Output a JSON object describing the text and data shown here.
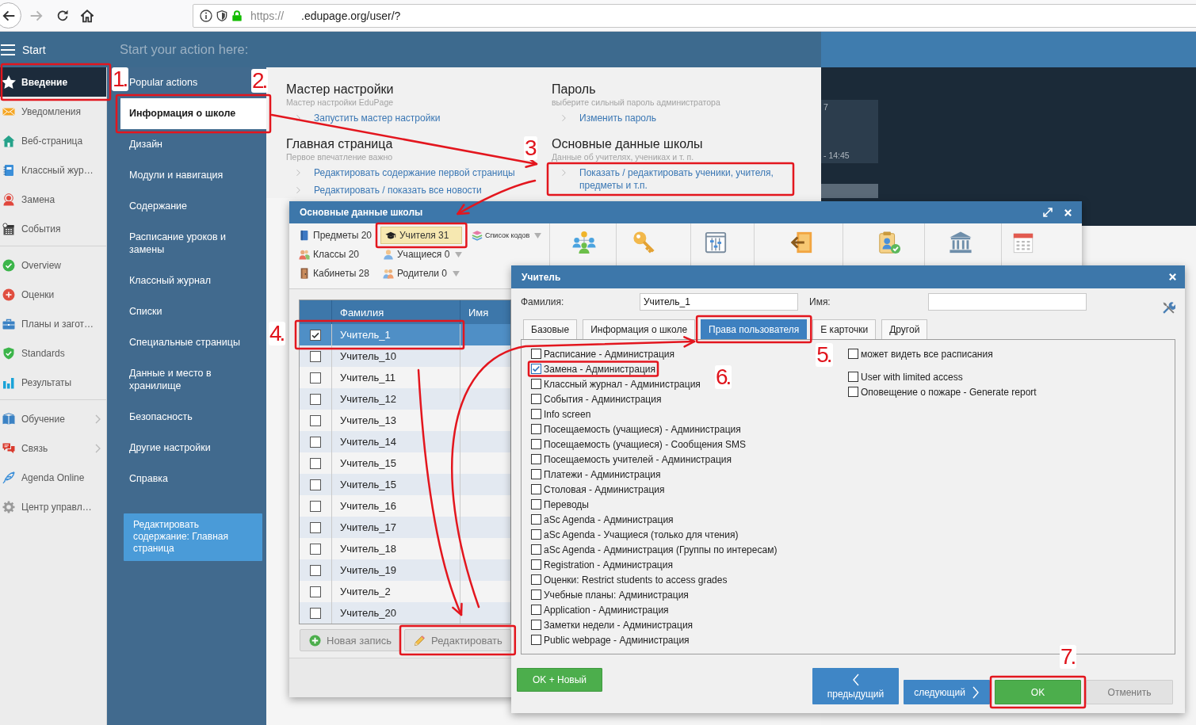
{
  "browser": {
    "url_scheme": "https://",
    "url_host": ".edupage.org/user/?"
  },
  "top_bar": {
    "start_label": "Start",
    "prompt": "Start your action here:"
  },
  "sidebar": {
    "groups": [
      {
        "items": [
          {
            "label": "Введение",
            "selected": true,
            "expandable": false,
            "highlight": {
              "step": "1.",
              "arrow_in": false
            }
          },
          {
            "label": "Уведомления",
            "selected": false,
            "expandable": false
          },
          {
            "label": "Веб-страница",
            "selected": false,
            "expandable": false
          },
          {
            "label": "Классный жур…",
            "selected": false,
            "expandable": false
          },
          {
            "label": "Замена",
            "selected": false,
            "expandable": false
          },
          {
            "label": "События",
            "selected": false,
            "expandable": false
          }
        ]
      },
      {
        "items": [
          {
            "label": "Overview",
            "selected": false,
            "expandable": false
          },
          {
            "label": "Оценки",
            "selected": false,
            "expandable": false
          },
          {
            "label": "Планы и загот…",
            "selected": false,
            "expandable": false
          },
          {
            "label": "Standards",
            "selected": false,
            "expandable": false
          },
          {
            "label": "Результаты",
            "selected": false,
            "expandable": false
          }
        ]
      },
      {
        "items": [
          {
            "label": "Обучение",
            "selected": false,
            "expandable": true
          },
          {
            "label": "Связь",
            "selected": false,
            "expandable": true
          },
          {
            "label": "Agenda Online",
            "selected": false,
            "expandable": false
          },
          {
            "label": "Центр управл…",
            "selected": false,
            "expandable": false
          }
        ]
      }
    ]
  },
  "menu": {
    "items": [
      {
        "label": "Popular actions",
        "selected": false
      },
      {
        "label": "Информация о школе",
        "selected": true,
        "highlight": {
          "step": "2.",
          "arrow_in": false
        }
      },
      {
        "label": "Дизайн",
        "selected": false
      },
      {
        "label": "Модули и навигация",
        "selected": false
      },
      {
        "label": "Содержание",
        "selected": false
      },
      {
        "label": "Расписание уроков и замены",
        "selected": false
      },
      {
        "label": "Классный журнал",
        "selected": false
      },
      {
        "label": "Списки",
        "selected": false
      },
      {
        "label": "Специальные страницы",
        "selected": false
      },
      {
        "label": "Данные и место в хранилище",
        "selected": false
      },
      {
        "label": "Безопасность",
        "selected": false
      },
      {
        "label": "Другие настройки",
        "selected": false
      },
      {
        "label": "Справка",
        "selected": false
      }
    ],
    "action_button": "Редактировать содержание: Главная страница"
  },
  "content": {
    "sections": [
      {
        "title": "Мастер настройки",
        "subtitle": "Мастер настройки EduPage",
        "links": [
          {
            "label": "Запустить мастер настройки"
          }
        ]
      },
      {
        "title": "Пароль",
        "subtitle": "выберите сильный пароль администратора",
        "links": [
          {
            "label": "Изменить пароль"
          }
        ]
      },
      {
        "title": "Главная страница",
        "subtitle": "Первое впечатление важно",
        "links": [
          {
            "label": "Редактировать содержание первой страницы"
          },
          {
            "label": "Редактировать / показать все новости"
          }
        ]
      },
      {
        "title": "Основные данные школы",
        "subtitle": "Данные об учителях, учениках и т. п.",
        "links": [
          {
            "label": "Показать / редактировать ученики, учителя, предметы и т.п.",
            "highlight": {
              "step": "3",
              "arrow_in": true
            }
          }
        ]
      }
    ]
  },
  "background_card": {
    "line_1": "7",
    "line_2": "- 14:45"
  },
  "school_data_dialog": {
    "title": "Основные данные школы",
    "toolbar_rows": [
      {
        "items": [
          {
            "label": "Предметы 20",
            "selected": false,
            "dropdown": false
          },
          {
            "label": "Учителя 31",
            "selected": true,
            "dropdown": false,
            "highlight": {
              "arrow_in": true
            }
          },
          {
            "label": "Список кодов",
            "selected": false,
            "dropdown": true
          }
        ]
      },
      {
        "items": [
          {
            "label": "Классы 20",
            "selected": false,
            "dropdown": false
          },
          {
            "label": "Учащиеся 0",
            "selected": false,
            "dropdown": true
          }
        ]
      },
      {
        "items": [
          {
            "label": "Кабинеты 28",
            "selected": false,
            "dropdown": false
          },
          {
            "label": "Родители 0",
            "selected": false,
            "dropdown": true
          }
        ]
      }
    ],
    "table": {
      "columns": [
        "Фамилия",
        "Имя"
      ],
      "rows": [
        {
          "surname": "Учитель_1",
          "checked": true,
          "selected": true,
          "highlight": {
            "step": "4.",
            "arrow_in": false
          }
        },
        {
          "surname": "Учитель_10",
          "checked": false,
          "selected": false
        },
        {
          "surname": "Учитель_11",
          "checked": false,
          "selected": false
        },
        {
          "surname": "Учитель_12",
          "checked": false,
          "selected": false
        },
        {
          "surname": "Учитель_13",
          "checked": false,
          "selected": false
        },
        {
          "surname": "Учитель_14",
          "checked": false,
          "selected": false
        },
        {
          "surname": "Учитель_15",
          "checked": false,
          "selected": false
        },
        {
          "surname": "Учитель_15",
          "checked": false,
          "selected": false
        },
        {
          "surname": "Учитель_16",
          "checked": false,
          "selected": false
        },
        {
          "surname": "Учитель_17",
          "checked": false,
          "selected": false
        },
        {
          "surname": "Учитель_18",
          "checked": false,
          "selected": false
        },
        {
          "surname": "Учитель_19",
          "checked": false,
          "selected": false
        },
        {
          "surname": "Учитель_2",
          "checked": false,
          "selected": false
        },
        {
          "surname": "Учитель_20",
          "checked": false,
          "selected": false
        }
      ]
    },
    "buttons": [
      {
        "label": "Новая запись",
        "kind": "add"
      },
      {
        "label": "Редактировать",
        "kind": "edit",
        "highlight": {
          "arrow_in": true
        }
      }
    ]
  },
  "teacher_dialog": {
    "title": "Учитель",
    "fields": [
      {
        "label": "Фамилия:",
        "value": "Учитель_1"
      },
      {
        "label": "Имя:"
      }
    ],
    "tabs": [
      {
        "label": "Базовые",
        "selected": false
      },
      {
        "label": "Информация о школе",
        "selected": false
      },
      {
        "label": "Права пользователя",
        "selected": true,
        "highlight": {
          "step": "5.",
          "arrow_in": true
        }
      },
      {
        "label": "Е карточки",
        "selected": false
      },
      {
        "label": "Другой",
        "selected": false
      }
    ],
    "permissions": [
      {
        "label": "Расписание - Администрация",
        "checked": false
      },
      {
        "label": "Замена - Администрация",
        "checked": true,
        "highlight": {
          "step": "6.",
          "arrow_in": false
        }
      },
      {
        "label": "Классный журнал - Администрация",
        "checked": false
      },
      {
        "label": "События - Администрация",
        "checked": false
      },
      {
        "label": "Info screen",
        "checked": false
      },
      {
        "label": "Посещаемость (учащиеся) - Администрация",
        "checked": false
      },
      {
        "label": "Посещаемость (учащиеся) - Сообщения SMS",
        "checked": false
      },
      {
        "label": "Посещаемость учителей - Администрация",
        "checked": false
      },
      {
        "label": "Платежи - Администрация",
        "checked": false
      },
      {
        "label": "Столовая - Администрация",
        "checked": false
      },
      {
        "label": "Переводы",
        "checked": false
      },
      {
        "label": "aSc Agenda - Администрация",
        "checked": false
      },
      {
        "label": "aSc Agenda - Учащиеся (только для чтения)",
        "checked": false
      },
      {
        "label": "aSc Agenda - Администрация (Группы по интересам)",
        "checked": false
      },
      {
        "label": "Registration - Администрация",
        "checked": false
      },
      {
        "label": "Оценки: Restrict students to access grades",
        "checked": false
      },
      {
        "label": "Учебные планы: Администрация",
        "checked": false
      },
      {
        "label": "Application - Администрация",
        "checked": false
      },
      {
        "label": "Заметки недели - Администрация",
        "checked": false
      },
      {
        "label": "Public webpage - Администрация",
        "checked": false
      }
    ],
    "permission_groups": [
      {
        "items": [
          {
            "label": "может видеть все расписания",
            "checked": false
          }
        ]
      },
      {
        "items": [
          {
            "label": "User with limited access",
            "checked": false
          },
          {
            "label": "Оповещение о пожаре - Generate report",
            "checked": false
          }
        ]
      }
    ],
    "buttons": [
      {
        "label": "OK + Новый",
        "kind": "ok_new"
      },
      {
        "label": "предыдущий",
        "kind": "previous"
      },
      {
        "label": "следующий",
        "kind": "next"
      },
      {
        "label": "OK",
        "kind": "ok",
        "highlight": {
          "step": "7.",
          "arrow_in": false
        }
      },
      {
        "label": "Отменить",
        "kind": "cancel"
      }
    ]
  }
}
